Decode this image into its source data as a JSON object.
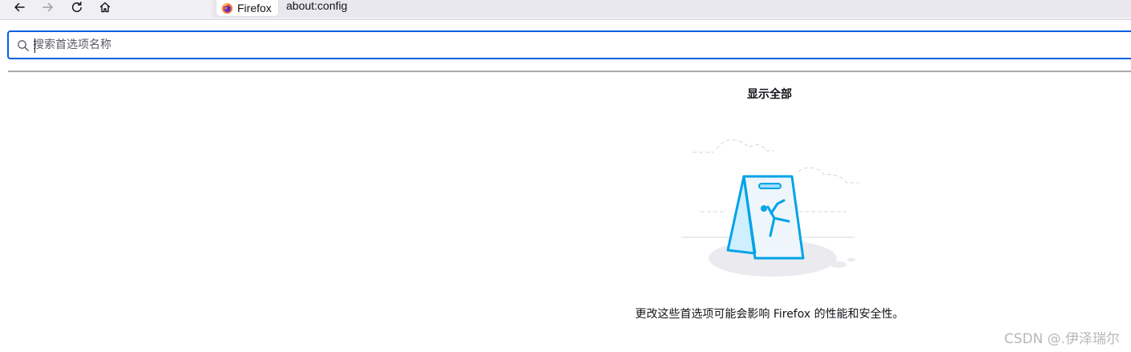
{
  "toolbar": {
    "tab_label": "Firefox",
    "url": "about:config"
  },
  "search": {
    "placeholder": "搜索首选项名称",
    "value": ""
  },
  "main": {
    "show_all_label": "显示全部",
    "warning_text": "更改这些首选项可能会影响 Firefox 的性能和安全性。"
  },
  "watermark": "CSDN @.伊泽瑞尔",
  "colors": {
    "accent": "#0061e0",
    "illustration_blue": "#00a3e8"
  },
  "icons": [
    "back-arrow-icon",
    "forward-arrow-icon",
    "reload-icon",
    "home-icon",
    "firefox-logo-icon",
    "search-icon",
    "caution-sign-illustration"
  ]
}
